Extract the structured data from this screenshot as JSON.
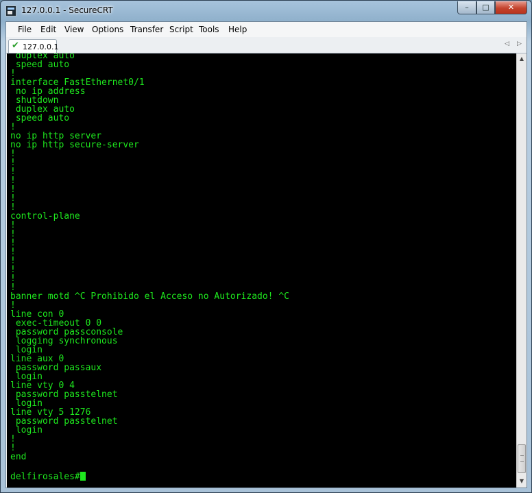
{
  "window": {
    "title": "127.0.0.1 - SecureCRT"
  },
  "window_controls": {
    "minimize": "–",
    "maximize": "□",
    "close": "✕"
  },
  "menu": [
    "File",
    "Edit",
    "View",
    "Options",
    "Transfer",
    "Script",
    "Tools",
    "Help"
  ],
  "tab": {
    "label": "127.0.0.1",
    "status_icon": "check-icon",
    "status_color": "#2fa12f"
  },
  "tab_nav": {
    "prev": "◁",
    "next": "▷"
  },
  "terminal": {
    "text_color": "#1ee81e",
    "background": "#000000",
    "lines": [
      " duplex auto",
      " speed auto",
      "!",
      "interface FastEthernet0/1",
      " no ip address",
      " shutdown",
      " duplex auto",
      " speed auto",
      "!",
      "no ip http server",
      "no ip http secure-server",
      "!",
      "!",
      "!",
      "!",
      "!",
      "!",
      "!",
      "control-plane",
      "!",
      "!",
      "!",
      "!",
      "!",
      "!",
      "!",
      "!",
      "banner motd ^C Prohibido el Acceso no Autorizado! ^C",
      "!",
      "line con 0",
      " exec-timeout 0 0",
      " password passconsole",
      " logging synchronous",
      " login",
      "line aux 0",
      " password passaux",
      " login",
      "line vty 0 4",
      " password passtelnet",
      " login",
      "line vty 5 1276",
      " password passtelnet",
      " login",
      "!",
      "!",
      "end",
      ""
    ],
    "prompt": "delfirosales#"
  },
  "scrollbar": {
    "up": "▲",
    "down": "▼",
    "position": 1.0
  }
}
